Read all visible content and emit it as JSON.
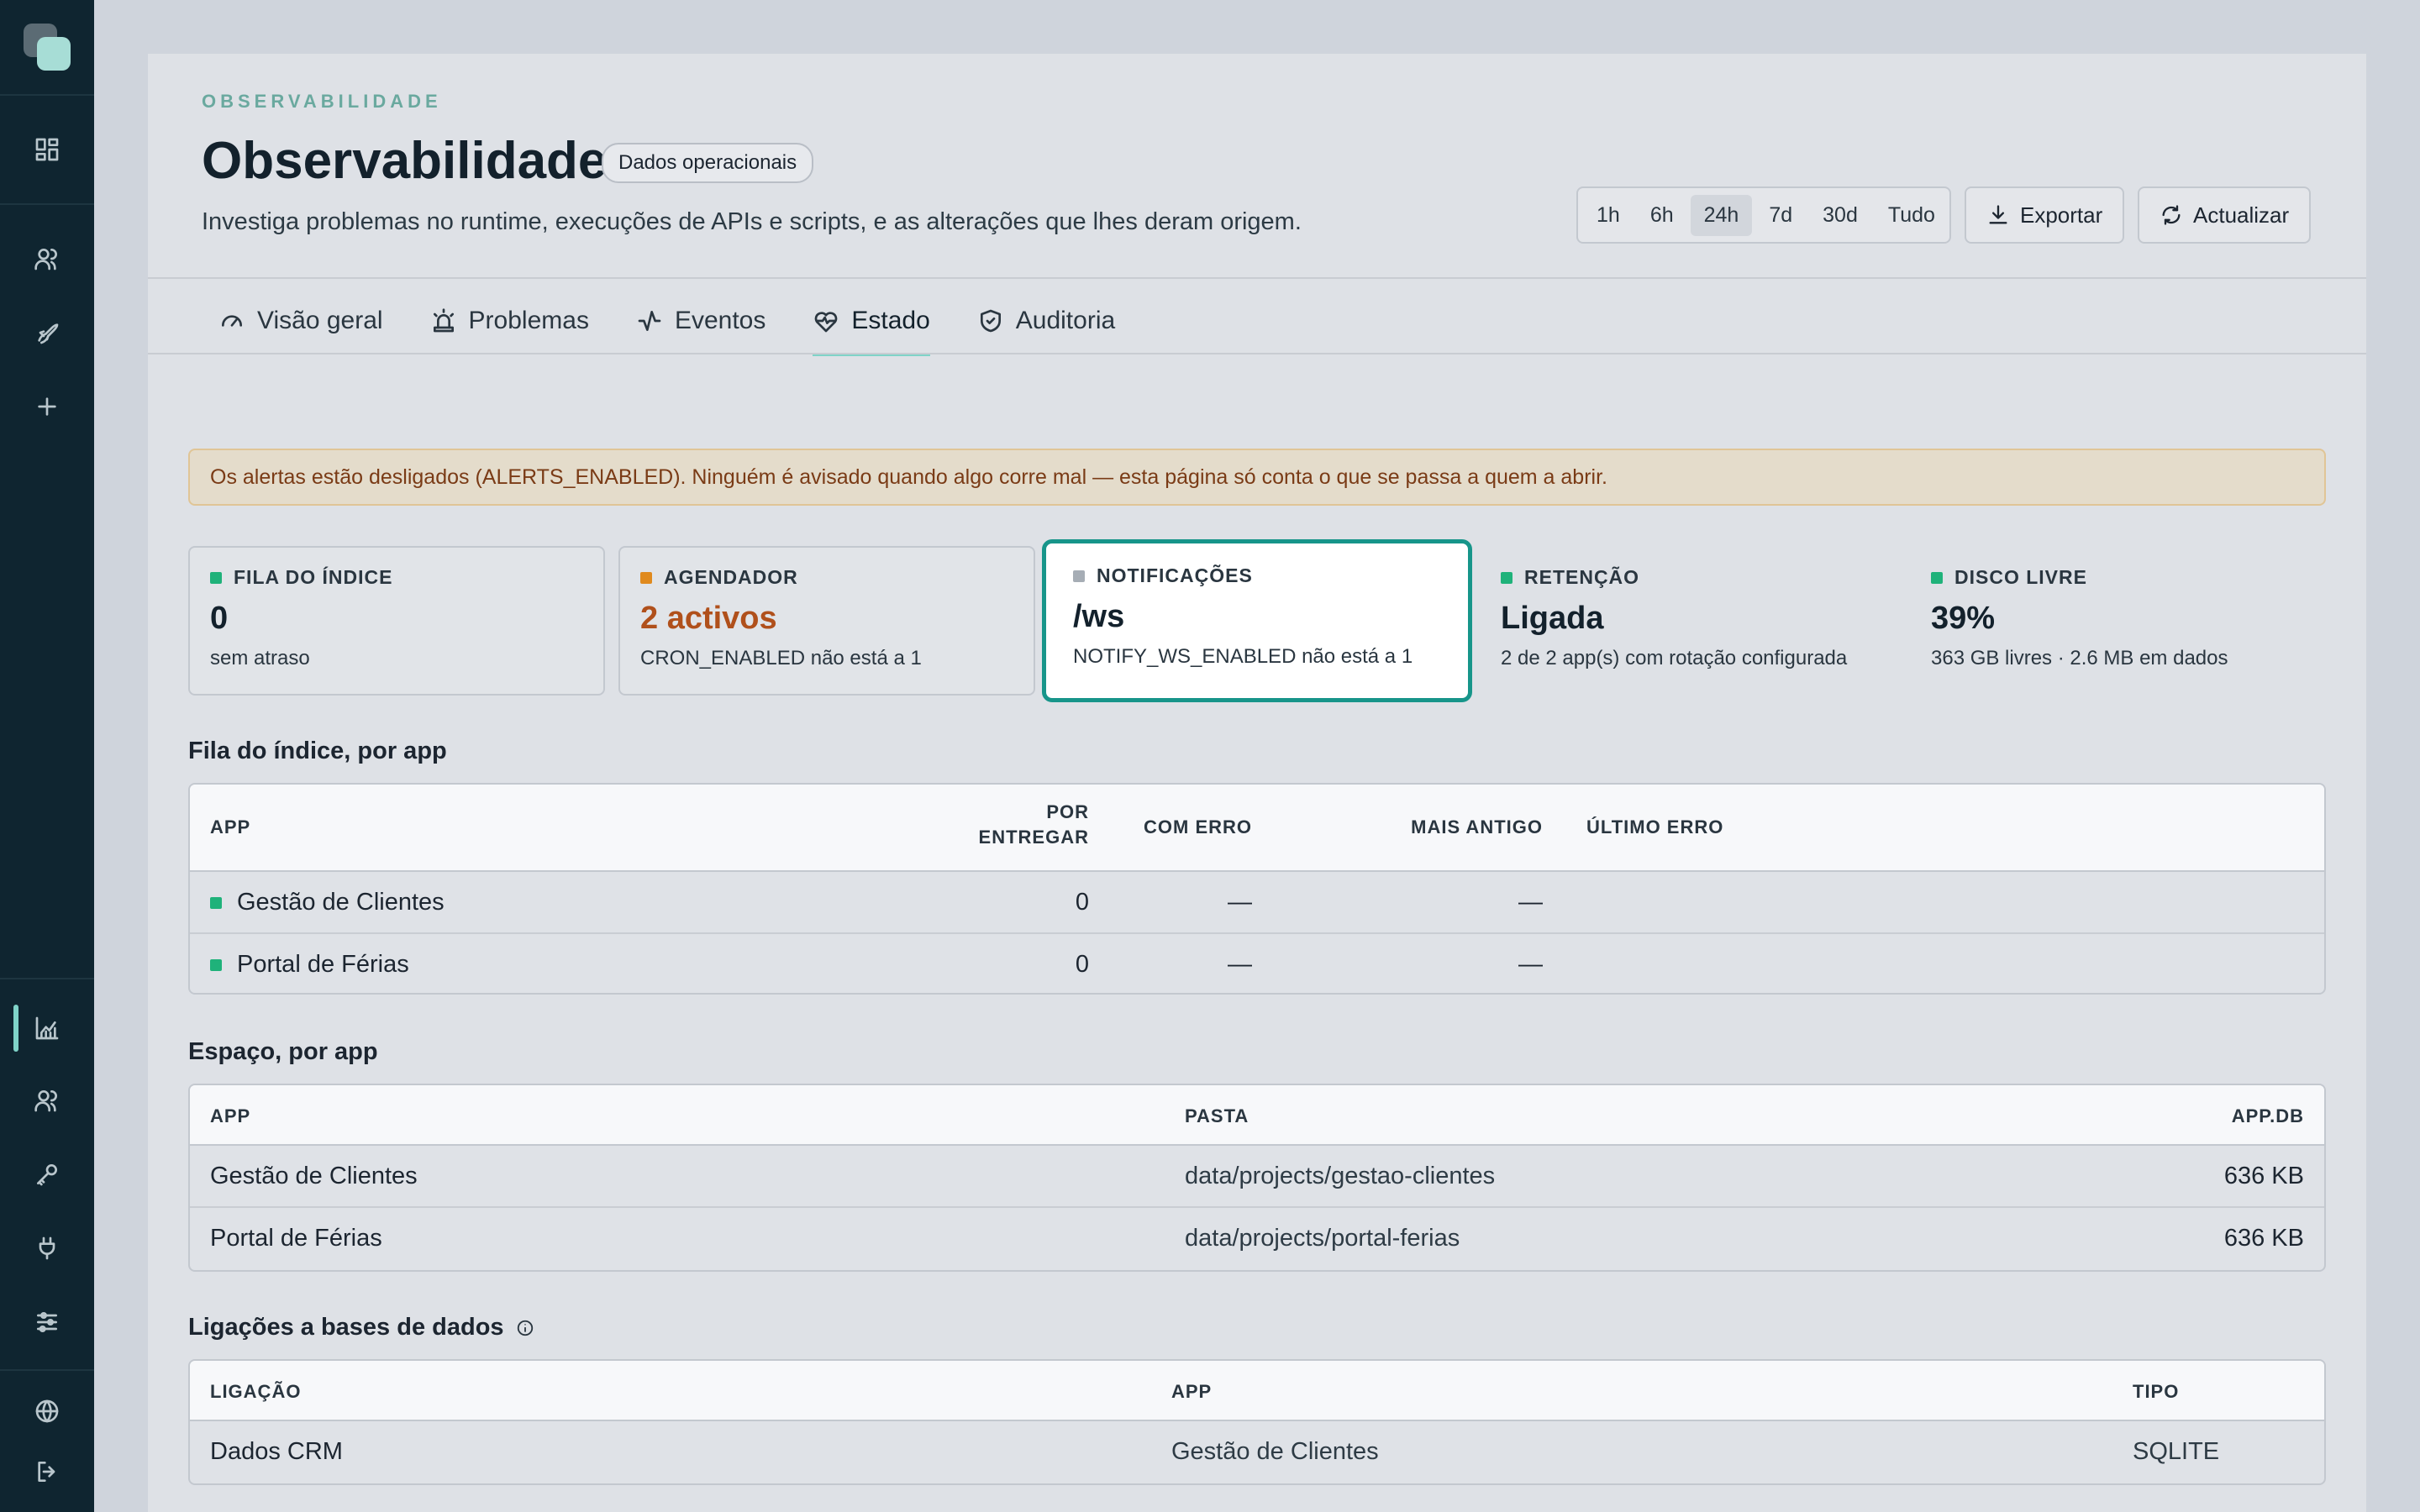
{
  "sidebar": {
    "items": [
      "dashboard-icon",
      "users-icon",
      "rocket-icon",
      "plus-icon",
      "chart-icon",
      "team-icon",
      "key-icon",
      "plug-icon",
      "sliders-icon",
      "globe-icon",
      "logout-icon"
    ]
  },
  "header": {
    "eyebrow": "OBSERVABILIDADE",
    "title": "Observabilidade",
    "badge": "Dados operacionais",
    "subtitle": "Investiga problemas no runtime, execuções de APIs e scripts, e as alterações que lhes deram origem.",
    "ranges": [
      "1h",
      "6h",
      "24h",
      "7d",
      "30d",
      "Tudo"
    ],
    "active_range": "24h",
    "export_label": "Exportar",
    "refresh_label": "Actualizar"
  },
  "tabs": [
    {
      "label": "Visão geral",
      "icon": "gauge-icon"
    },
    {
      "label": "Problemas",
      "icon": "siren-icon"
    },
    {
      "label": "Eventos",
      "icon": "activity-icon"
    },
    {
      "label": "Estado",
      "icon": "heart-pulse-icon"
    },
    {
      "label": "Auditoria",
      "icon": "shield-check-icon"
    }
  ],
  "active_tab": "Estado",
  "alert": "Os alertas estão desligados (ALERTS_ENABLED). Ninguém é avisado quando algo corre mal — esta página só conta o que se passa a quem a abrir.",
  "cards": [
    {
      "label": "FILA DO ÍNDICE",
      "value": "0",
      "sub": "sem atraso",
      "color": "#1fb27a"
    },
    {
      "label": "AGENDADOR",
      "value": "2 activos",
      "sub": "CRON_ENABLED não está a 1",
      "color": "#e08a1e"
    },
    {
      "label": "NOTIFICAÇÕES",
      "value": "/ws",
      "sub": "NOTIFY_WS_ENABLED não está a 1",
      "color": "#a6adb5"
    },
    {
      "label": "RETENÇÃO",
      "value": "Ligada",
      "sub": "2 de 2 app(s) com rotação configurada",
      "color": "#1fb27a"
    },
    {
      "label": "DISCO LIVRE",
      "value": "39%",
      "sub": "363 GB livres · 2.6 MB em dados",
      "color": "#1fb27a"
    }
  ],
  "queue": {
    "title": "Fila do índice, por app",
    "headers": {
      "app": "APP",
      "pending_1": "POR",
      "pending_2": "ENTREGAR",
      "errors": "COM ERRO",
      "oldest": "MAIS ANTIGO",
      "last_error": "ÚLTIMO ERRO"
    },
    "rows": [
      {
        "app": "Gestão de Clientes",
        "pending": "0",
        "errors": "—",
        "oldest": "—",
        "last_error": ""
      },
      {
        "app": "Portal de Férias",
        "pending": "0",
        "errors": "—",
        "oldest": "—",
        "last_error": ""
      }
    ]
  },
  "space": {
    "title": "Espaço, por app",
    "headers": {
      "app": "APP",
      "folder": "PASTA",
      "db": "APP.DB"
    },
    "rows": [
      {
        "app": "Gestão de Clientes",
        "folder": "data/projects/gestao-clientes",
        "db": "636 KB"
      },
      {
        "app": "Portal de Férias",
        "folder": "data/projects/portal-ferias",
        "db": "636 KB"
      }
    ]
  },
  "connections": {
    "title": "Ligações a bases de dados",
    "headers": {
      "connection": "LIGAÇÃO",
      "app": "APP",
      "type": "TIPO"
    },
    "rows": [
      {
        "connection": "Dados CRM",
        "app": "Gestão de Clientes",
        "type": "SQLITE"
      }
    ]
  }
}
